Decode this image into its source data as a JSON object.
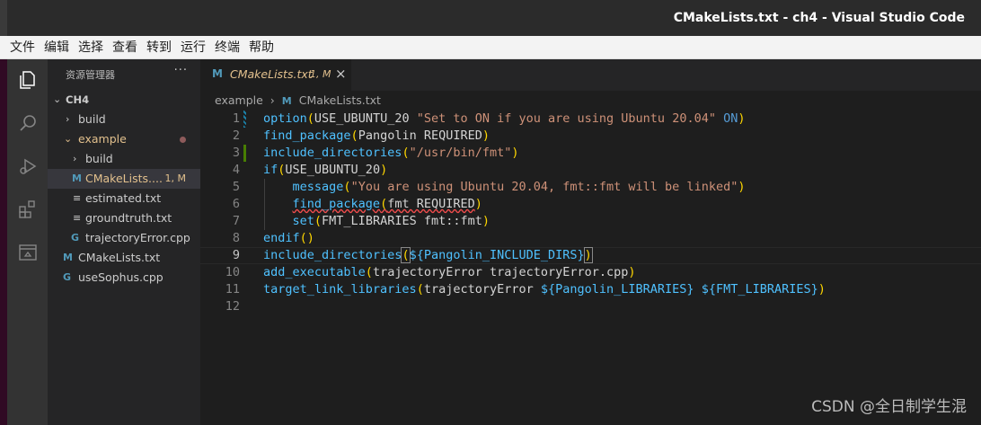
{
  "window": {
    "title": "CMakeLists.txt - ch4 - Visual Studio Code"
  },
  "menu": [
    "文件",
    "编辑",
    "选择",
    "查看",
    "转到",
    "运行",
    "终端",
    "帮助"
  ],
  "activity_bar": [
    {
      "name": "explorer-icon",
      "glyph": "⧉"
    },
    {
      "name": "search-icon",
      "glyph": "⌕"
    },
    {
      "name": "run-debug-icon",
      "glyph": "▷"
    },
    {
      "name": "extensions-icon",
      "glyph": "⊞"
    },
    {
      "name": "remote-explorer-icon",
      "glyph": "▭"
    }
  ],
  "explorer": {
    "header": "资源管理器",
    "more": "···",
    "tree": [
      {
        "label": "CH4",
        "type": "root",
        "expanded": true,
        "indent": 0
      },
      {
        "label": "build",
        "type": "folder",
        "expanded": false,
        "indent": 1
      },
      {
        "label": "example",
        "type": "folder",
        "expanded": true,
        "indent": 1,
        "modified_dot": true
      },
      {
        "label": "build",
        "type": "folder",
        "expanded": false,
        "indent": 2
      },
      {
        "label": "CMakeLists....",
        "type": "cmake",
        "indent": 2,
        "selected": true,
        "badge": "1, M"
      },
      {
        "label": "estimated.txt",
        "type": "text",
        "indent": 2
      },
      {
        "label": "groundtruth.txt",
        "type": "text",
        "indent": 2
      },
      {
        "label": "trajectoryError.cpp",
        "type": "cpp",
        "indent": 2
      },
      {
        "label": "CMakeLists.txt",
        "type": "cmake",
        "indent": 1
      },
      {
        "label": "useSophus.cpp",
        "type": "cpp",
        "indent": 1
      }
    ]
  },
  "tab": {
    "icon": "M",
    "name": "CMakeLists.txt",
    "badge": "1, M",
    "close": "×"
  },
  "breadcrumb": {
    "folder": "example",
    "separator": "›",
    "file_icon": "M",
    "file": "CMakeLists.txt"
  },
  "editor": {
    "active_line": 9,
    "lines": [
      {
        "n": "1",
        "text": "option(USE_UBUNTU_20 \"Set to ON if you are using Ubuntu 20.04\" ON)"
      },
      {
        "n": "2",
        "text": "find_package(Pangolin REQUIRED)"
      },
      {
        "n": "3",
        "text": "include_directories(\"/usr/bin/fmt\")"
      },
      {
        "n": "4",
        "text": "if(USE_UBUNTU_20)"
      },
      {
        "n": "5",
        "text": "    message(\"You are using Ubuntu 20.04, fmt::fmt will be linked\")"
      },
      {
        "n": "6",
        "text": "    find_package(fmt REQUIRED)"
      },
      {
        "n": "7",
        "text": "    set(FMT_LIBRARIES fmt::fmt)"
      },
      {
        "n": "8",
        "text": "endif()"
      },
      {
        "n": "9",
        "text": "include_directories(${Pangolin_INCLUDE_DIRS})"
      },
      {
        "n": "10",
        "text": "add_executable(trajectoryError trajectoryError.cpp)"
      },
      {
        "n": "11",
        "text": "target_link_libraries(trajectoryError ${Pangolin_LIBRARIES} ${FMT_LIBRARIES})"
      },
      {
        "n": "12",
        "text": ""
      }
    ],
    "gutter_marks": [
      {
        "line": 1,
        "kind": "modified",
        "color": "#1b81a8"
      },
      {
        "line": 3,
        "kind": "added",
        "color": "#487e02"
      }
    ]
  },
  "watermark": "CSDN @全日制学生混",
  "colors": {
    "titlebar": "#2b2b2b",
    "menubar": "#f3f3f3",
    "activitybar": "#333333",
    "sidebar": "#252526",
    "editor": "#1e1e1e",
    "modified": "#e2c08d",
    "cmake_icon": "#519aba",
    "cpp_icon": "#519aba"
  }
}
